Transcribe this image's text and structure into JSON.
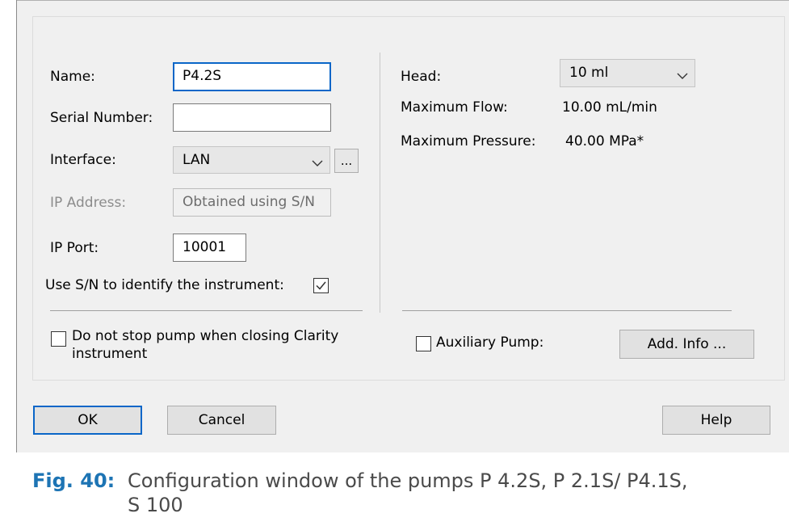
{
  "form": {
    "name_label": "Name:",
    "name_value": "P4.2S",
    "serial_label": "Serial Number:",
    "serial_value": "",
    "interface_label": "Interface:",
    "interface_value": "LAN",
    "ellipsis_label": "...",
    "ip_address_label": "IP Address:",
    "ip_address_value": "Obtained using S/N",
    "ip_port_label": "IP Port:",
    "ip_port_value": "10001",
    "use_sn_label": "Use S/N to identify the instrument:",
    "use_sn_checked": true,
    "no_stop_label_line1": "Do not stop pump when closing Clarity",
    "no_stop_label_line2": "instrument",
    "no_stop_checked": false
  },
  "info": {
    "head_label": "Head:",
    "head_value": "10 ml",
    "max_flow_label": "Maximum Flow:",
    "max_flow_value": "10.00 mL/min",
    "max_pressure_label": "Maximum Pressure:",
    "max_pressure_value": "40.00 MPa*",
    "aux_pump_label": "Auxiliary Pump:",
    "aux_pump_checked": false,
    "add_info_label": "Add. Info ..."
  },
  "buttons": {
    "ok": "OK",
    "cancel": "Cancel",
    "help": "Help"
  },
  "caption": {
    "number": "Fig. 40:",
    "line1": "Configuration window of the pumps P 4.2S, P 2.1S/ P4.1S,",
    "line2": "S 100"
  },
  "colors": {
    "focus_border": "#0a66c8",
    "caption_number": "#1d74b4"
  }
}
